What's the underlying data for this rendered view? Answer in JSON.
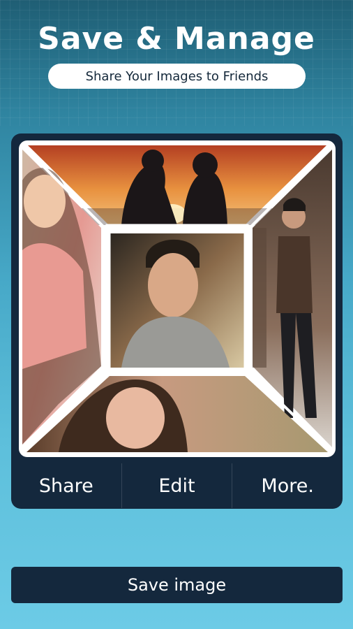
{
  "header": {
    "title": "Save & Manage",
    "subtitle": "Share Your Images to Friends"
  },
  "collage": {
    "photos": [
      {
        "name": "couple-sunset-photo",
        "position": "top"
      },
      {
        "name": "smiling-woman-photo",
        "position": "left"
      },
      {
        "name": "man-portrait-photo",
        "position": "center"
      },
      {
        "name": "man-standing-photo",
        "position": "right"
      },
      {
        "name": "woman-closeup-photo",
        "position": "bottom"
      }
    ]
  },
  "actions": {
    "share_label": "Share",
    "edit_label": "Edit",
    "more_label": "More."
  },
  "save_button": {
    "label": "Save image"
  },
  "colors": {
    "card_bg": "#14283d",
    "frame_border": "#ffffff",
    "bg_top": "#1f5e74",
    "bg_bottom": "#6ccbe6"
  }
}
